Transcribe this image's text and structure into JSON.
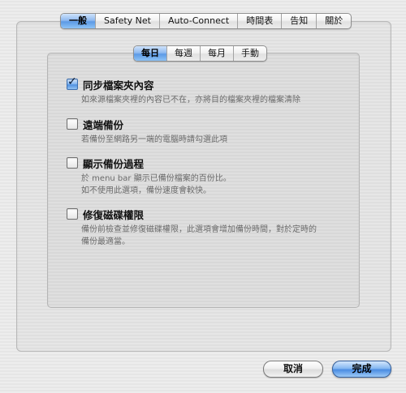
{
  "top_tabs": [
    {
      "label": "一般",
      "active": true
    },
    {
      "label": "Safety Net",
      "active": false
    },
    {
      "label": "Auto-Connect",
      "active": false
    },
    {
      "label": "時間表",
      "active": false
    },
    {
      "label": "告知",
      "active": false
    },
    {
      "label": "關於",
      "active": false
    }
  ],
  "sub_tabs": [
    {
      "label": "每日",
      "active": true
    },
    {
      "label": "每週",
      "active": false
    },
    {
      "label": "每月",
      "active": false
    },
    {
      "label": "手動",
      "active": false
    }
  ],
  "options": [
    {
      "label": "同步檔案夾內容",
      "checked": true,
      "description": [
        "如來源檔案夾裡的內容已不在，亦將目的檔案夾裡的檔案清除"
      ]
    },
    {
      "label": "遠端備份",
      "checked": false,
      "description": [
        "若備份至網路另一端的電腦時請勾選此項"
      ]
    },
    {
      "label": "顯示備份過程",
      "checked": false,
      "description": [
        "於 menu bar 顯示已備份檔案的百份比。",
        "如不使用此選項，備份速度會較快。"
      ]
    },
    {
      "label": "修復磁碟權限",
      "checked": false,
      "description": [
        "備份前檢查並修復磁碟權限，此選項會增加備份時間，對於定時的",
        "備份最適當。"
      ]
    }
  ],
  "buttons": {
    "cancel_label": "取消",
    "done_label": "完成"
  },
  "colors": {
    "accent": "#5d9ae6",
    "description_text": "#6a6a6a"
  }
}
